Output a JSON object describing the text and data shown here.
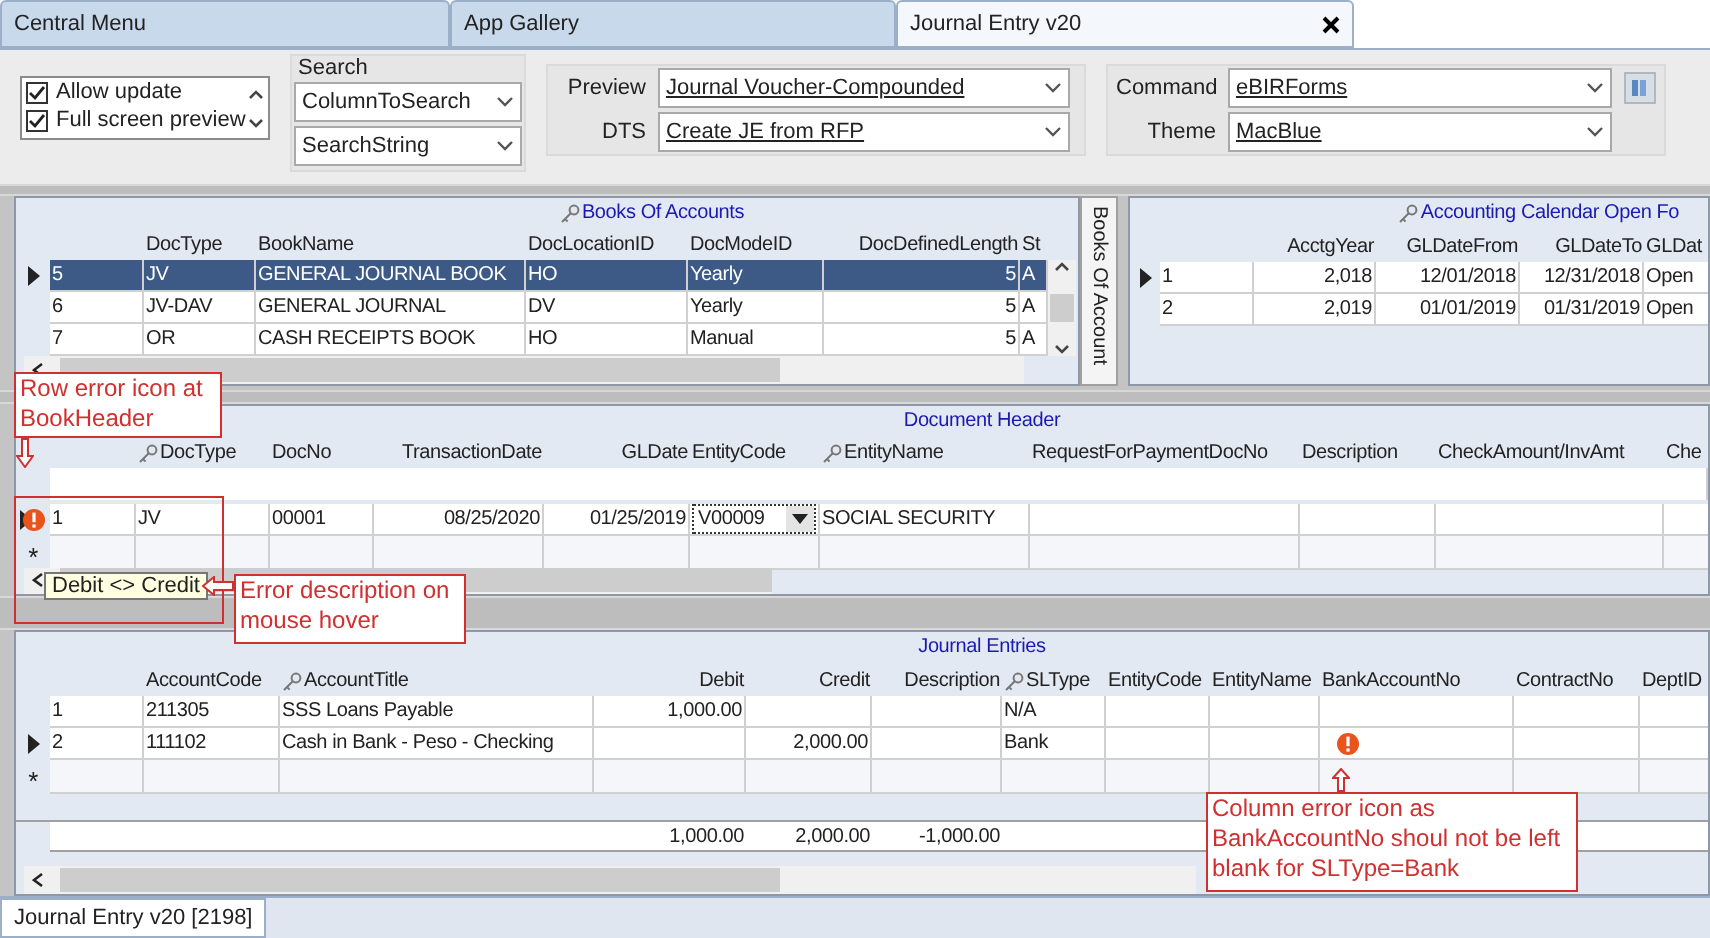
{
  "tabs": [
    {
      "label": "Central Menu",
      "selected": false
    },
    {
      "label": "App Gallery",
      "selected": false
    },
    {
      "label": "Journal Entry v20",
      "selected": true
    }
  ],
  "options": [
    {
      "label": "Allow update",
      "checked": true
    },
    {
      "label": "Full screen preview",
      "checked": true
    }
  ],
  "search": {
    "label": "Search",
    "column": "ColumnToSearch",
    "text": "SearchString"
  },
  "preview": {
    "label": "Preview",
    "value": "Journal Voucher-Compounded"
  },
  "dts": {
    "label": "DTS",
    "value": "Create JE from RFP"
  },
  "command": {
    "label": "Command",
    "value": "eBIRForms"
  },
  "theme": {
    "label": "Theme",
    "value": "MacBlue"
  },
  "books_of_accounts": {
    "title": "Books Of Accounts",
    "columns": [
      {
        "kind": "number"
      },
      {
        "label": "DocType",
        "keyed": false
      },
      {
        "label": "BookName",
        "keyed": false
      },
      {
        "label": "DocLocationID",
        "keyed": false
      },
      {
        "label": "DocModeID",
        "keyed": false
      },
      {
        "label": "DocDefinedLength",
        "keyed": false
      },
      {
        "label": "St",
        "keyed": false
      }
    ],
    "rows": [
      {
        "selected": true,
        "current": true,
        "error": false,
        "cells": [
          "5",
          "JV",
          "GENERAL JOURNAL BOOK",
          "HO",
          "Yearly",
          "5",
          "A"
        ]
      },
      {
        "selected": false,
        "current": false,
        "error": false,
        "cells": [
          "6",
          "JV-DAV",
          "GENERAL JOURNAL",
          "DV",
          "Yearly",
          "5",
          "A"
        ]
      },
      {
        "selected": false,
        "current": false,
        "error": false,
        "cells": [
          "7",
          "OR",
          "CASH RECEIPTS BOOK",
          "HO",
          "Manual",
          "5",
          "A"
        ]
      }
    ]
  },
  "side_tab": {
    "label": "Books Of Account"
  },
  "accounting_calendar": {
    "title": "Accounting Calendar Open Fo",
    "columns": [
      {
        "kind": "number"
      },
      {
        "label": "AcctgYear",
        "keyed": false
      },
      {
        "label": "GLDateFrom",
        "keyed": false
      },
      {
        "label": "GLDateTo",
        "keyed": false
      },
      {
        "label": "GLDat",
        "keyed": false
      }
    ],
    "rows": [
      {
        "selected": false,
        "current": true,
        "error": false,
        "cells": [
          "1",
          "2,018",
          "12/01/2018",
          "12/31/2018",
          "Open"
        ]
      },
      {
        "selected": false,
        "current": false,
        "error": false,
        "cells": [
          "2",
          "2,019",
          "01/01/2019",
          "01/31/2019",
          "Open"
        ]
      }
    ]
  },
  "document_header": {
    "title": "Document Header",
    "columns": [
      {
        "kind": "number"
      },
      {
        "label": "DocType",
        "keyed": true
      },
      {
        "label": "DocNo",
        "keyed": false
      },
      {
        "label": "TransactionDate",
        "keyed": false
      },
      {
        "label": "GLDate",
        "keyed": false
      },
      {
        "label": "EntityCode",
        "keyed": false
      },
      {
        "label": "EntityName",
        "keyed": true
      },
      {
        "label": "RequestForPaymentDocNo",
        "keyed": false
      },
      {
        "label": "Description",
        "keyed": false
      },
      {
        "label": "CheckAmount/InvAmt",
        "keyed": false
      },
      {
        "label": "Che",
        "keyed": false
      }
    ],
    "rows": [
      {
        "selected": false,
        "current": true,
        "error": true,
        "cells": [
          "1",
          "JV",
          "00001",
          "08/25/2020",
          "01/25/2019",
          {
            "kind": "dropdown",
            "text": "V00009"
          },
          "SOCIAL SECURITY",
          "",
          "",
          "",
          ""
        ]
      },
      {
        "kind": "new",
        "marker": "*"
      }
    ],
    "tooltip": "Debit <> Credit"
  },
  "journal_entries": {
    "title": "Journal Entries",
    "columns": [
      {
        "kind": "number"
      },
      {
        "label": "AccountCode",
        "keyed": false
      },
      {
        "label": "AccountTitle",
        "keyed": true
      },
      {
        "label": "Debit",
        "keyed": false
      },
      {
        "label": "Credit",
        "keyed": false
      },
      {
        "label": "Description",
        "keyed": false
      },
      {
        "label": "SLType",
        "keyed": true
      },
      {
        "label": "EntityCode",
        "keyed": false
      },
      {
        "label": "EntityName",
        "keyed": false
      },
      {
        "label": "BankAccountNo",
        "keyed": false
      },
      {
        "label": "ContractNo",
        "keyed": false
      },
      {
        "label": "DeptID",
        "keyed": false
      }
    ],
    "rows": [
      {
        "selected": false,
        "current": false,
        "error": false,
        "cells": [
          "1",
          "211305",
          "SSS Loans Payable",
          "1,000.00",
          "",
          "",
          "N/A",
          "",
          "",
          "",
          "",
          ""
        ]
      },
      {
        "selected": false,
        "current": true,
        "error": false,
        "cells": [
          "2",
          "111102",
          "Cash in Bank - Peso - Checking",
          "",
          "2,000.00",
          "",
          "Bank",
          "",
          "",
          {
            "kind": "error"
          },
          "",
          ""
        ]
      },
      {
        "kind": "new",
        "marker": "*"
      }
    ],
    "totals": [
      {
        "kind": "blank"
      },
      {
        "kind": "blank"
      },
      {
        "kind": "blank"
      },
      {
        "kind": "amount",
        "text": "1,000.00"
      },
      {
        "kind": "amount",
        "text": "2,000.00"
      },
      {
        "kind": "amount",
        "text": "-1,000.00"
      },
      {
        "kind": "blank"
      },
      {
        "kind": "blank"
      },
      {
        "kind": "blank"
      },
      {
        "kind": "blank"
      },
      {
        "kind": "blank"
      },
      {
        "kind": "blank"
      }
    ]
  },
  "status_bar": {
    "label": "Journal Entry v20 [2198]"
  },
  "annotations": [
    {
      "text": "Row error icon at BookHeader"
    },
    {
      "text": "Error description on mouse hover"
    },
    {
      "text": "Column error icon as BankAccountNo shoul not be left blank for SLType=Bank"
    }
  ]
}
